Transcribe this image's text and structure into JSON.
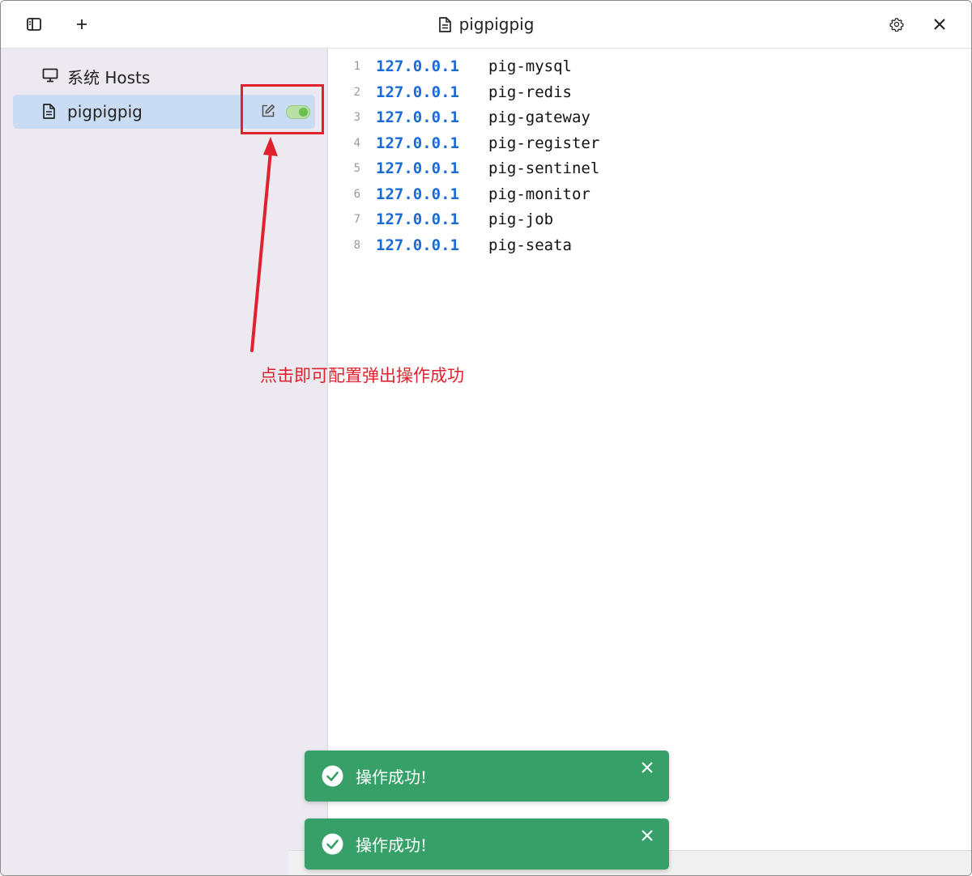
{
  "window": {
    "title": "pigpigpig"
  },
  "toolbar": {
    "sidebar_toggle_icon": "sidebar-toggle-icon",
    "add_icon": "plus-icon",
    "settings_icon": "gear-icon",
    "close_icon": "close-icon"
  },
  "sidebar": {
    "items": [
      {
        "label": "系统 Hosts",
        "icon": "monitor-icon",
        "active": false
      },
      {
        "label": "pigpigpig",
        "icon": "document-icon",
        "active": true,
        "enabled": true
      }
    ]
  },
  "editor": {
    "lines": [
      {
        "num": "1",
        "ip": "127.0.0.1",
        "host": "pig-mysql"
      },
      {
        "num": "2",
        "ip": "127.0.0.1",
        "host": "pig-redis"
      },
      {
        "num": "3",
        "ip": "127.0.0.1",
        "host": "pig-gateway"
      },
      {
        "num": "4",
        "ip": "127.0.0.1",
        "host": "pig-register"
      },
      {
        "num": "5",
        "ip": "127.0.0.1",
        "host": "pig-sentinel"
      },
      {
        "num": "6",
        "ip": "127.0.0.1",
        "host": "pig-monitor"
      },
      {
        "num": "7",
        "ip": "127.0.0.1",
        "host": "pig-job"
      },
      {
        "num": "8",
        "ip": "127.0.0.1",
        "host": "pig-seata"
      }
    ]
  },
  "annotation": {
    "text": "点击即可配置弹出操作成功",
    "color": "#e0222e"
  },
  "toasts": [
    {
      "message": "操作成功!"
    },
    {
      "message": "操作成功!"
    }
  ],
  "colors": {
    "accent": "#1a6bd4",
    "toast": "#37a069",
    "sidebar_active": "#c9dcf4",
    "toggle_on": "#6bbf4e"
  }
}
